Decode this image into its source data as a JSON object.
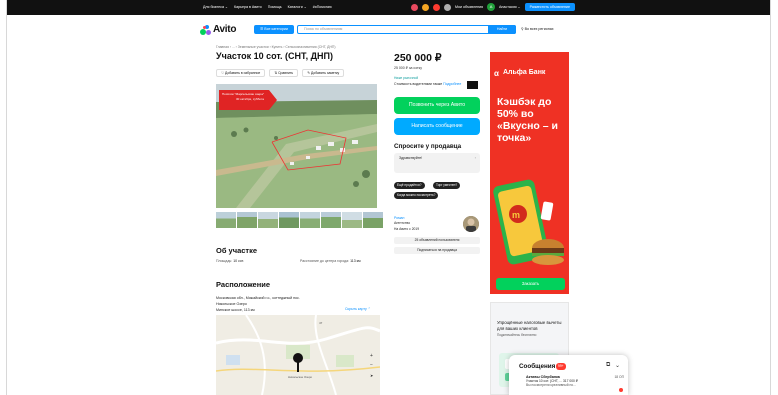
{
  "topbar": {
    "left_links": [
      "Для бизнеса ⌄",
      "Карьера в Авито",
      "Помощь",
      "Каталоги ⌄",
      "#яПомогаю"
    ],
    "messages_label": "Мои объявления",
    "avatar_letter": "А",
    "user_name": "Анастасия ⌄",
    "post_button": "Разместить объявление"
  },
  "header": {
    "logo_text": "Avito",
    "categories_button": "☰ Все категории",
    "search_placeholder": "Поиск по объявлениям",
    "search_button": "Найти",
    "region": "Во всех регионах"
  },
  "listing": {
    "breadcrumbs": "Главная › ... › Земельные участки › Купить › Сельхозназначения (СНТ, ДНП)",
    "title": "Участок 10 сот. (СНТ, ДНП)",
    "actions": [
      "♡ Добавить в избранное",
      "⇅ Сравнить",
      "✎ Добавить заметку"
    ],
    "photo_badge_line1": "Посёлок \"Марсельские озера\"",
    "photo_badge_line2": "30 октября, суббота"
  },
  "about": {
    "heading": "Об участке",
    "area_label": "Площадь:",
    "area_value": "10 сот.",
    "distance_label": "Расстояние до центра города:",
    "distance_value": "113 км"
  },
  "location": {
    "heading": "Расположение",
    "line1": "Московская обл., Можайский г.о., коттеджный пос.",
    "line2": "Никольское Озеро",
    "line3": "Минское шоссе, 113 км",
    "hide_map": "Скрыть карту ⌃",
    "map_labels": [
      "Никольское Озеро",
      "47"
    ],
    "zoom_in": "+",
    "zoom_out": "−",
    "locate": "➤"
  },
  "sidebar": {
    "price": "250 000 ₽",
    "price_per_sotka": "25 000 ₽ за сотку",
    "low_price": "Ниже рыночной",
    "other_sellers": "Стоимость водителями также",
    "other_sellers_link": "Подробнее",
    "call_button": "Позвонить через Авито",
    "message_button": "Написать сообщение",
    "ask_heading": "Спросите у продавца",
    "ask_placeholder": "Здравствуйте!",
    "chips": [
      "Ещё продаётся?",
      "Торг уместен?",
      "Когда можно посмотреть?"
    ],
    "seller_name": "Роман",
    "seller_type": "Агентство",
    "seller_since": "На Авито с 2019",
    "seller_listings": "25 объявлений пользователя",
    "subscribe": "Подписаться на продавца"
  },
  "ads": {
    "ad1_bank": "Альфа Банк",
    "ad1_promo": "Кэшбэк до 50% во «Вкусно – и точка»",
    "ad1_button": "Заказать",
    "ad2_title": "Упрощённые налоговые вычеты для ваших клиентов",
    "ad2_sub": "Подключайтесь бесплатно"
  },
  "messages": {
    "title": "Сообщения",
    "count": "99+",
    "name": "Активы Сбербанка",
    "date": "18 ОП",
    "line2": "Участок 10 сот. (СНТ, ...  317 000 ₽",
    "line3": "Вы посмотрели креативный но..."
  }
}
